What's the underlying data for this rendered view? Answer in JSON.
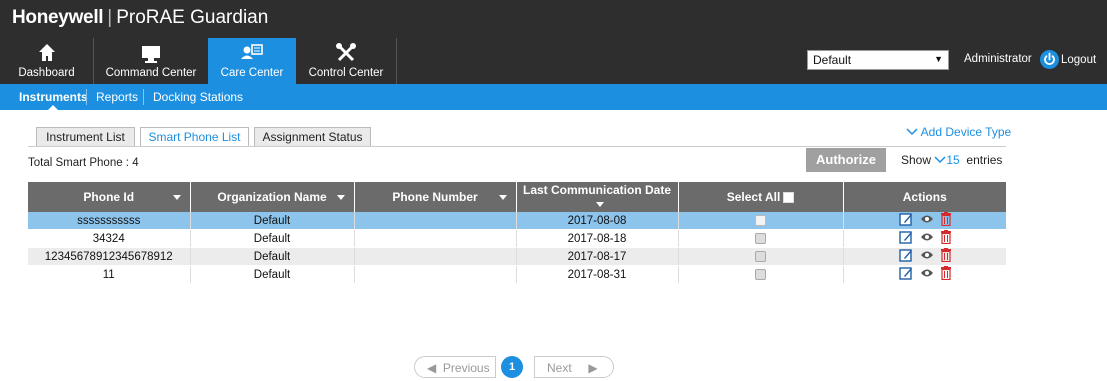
{
  "brand": {
    "company": "Honeywell",
    "separator": "|",
    "product": "ProRAE Guardian"
  },
  "nav": {
    "items": [
      {
        "label": "Dashboard",
        "icon": "home-icon"
      },
      {
        "label": "Command Center",
        "icon": "monitor-icon"
      },
      {
        "label": "Care Center",
        "icon": "care-center-icon",
        "active": true
      },
      {
        "label": "Control Center",
        "icon": "tools-icon"
      }
    ],
    "role_select": "Default",
    "user": "Administrator",
    "logout": "Logout"
  },
  "subnav": {
    "items": [
      {
        "label": "Instruments",
        "active": true
      },
      {
        "label": "Reports"
      },
      {
        "label": "Docking Stations"
      }
    ]
  },
  "tabs": [
    {
      "label": "Instrument List"
    },
    {
      "label": "Smart Phone List",
      "active": true
    },
    {
      "label": "Assignment Status"
    }
  ],
  "add_device_type": "Add Device Type",
  "total_label": "Total Smart Phone : 4",
  "authorize_label": "Authorize",
  "show": {
    "prefix": "Show",
    "value": "15",
    "suffix": "entries"
  },
  "table": {
    "headers": {
      "phone_id": "Phone Id",
      "org_name": "Organization Name",
      "phone_number": "Phone Number",
      "last_comm": "Last Communication Date",
      "select_all": "Select All",
      "actions": "Actions"
    },
    "rows": [
      {
        "phone_id": "sssssssssss",
        "org": "Default",
        "phone": "",
        "date": "2017-08-08"
      },
      {
        "phone_id": "34324",
        "org": "Default",
        "phone": "",
        "date": "2017-08-18"
      },
      {
        "phone_id": "12345678912345678912",
        "org": "Default",
        "phone": "",
        "date": "2017-08-17"
      },
      {
        "phone_id": "11",
        "org": "Default",
        "phone": "",
        "date": "2017-08-31"
      }
    ]
  },
  "pagination": {
    "previous": "Previous",
    "current": "1",
    "next": "Next"
  },
  "colors": {
    "accent": "#1d8fe0",
    "header_bg": "#2e2e2e",
    "table_header": "#6b6b6b",
    "selected_row": "#8dc4ec",
    "delete": "#d62b2b"
  }
}
